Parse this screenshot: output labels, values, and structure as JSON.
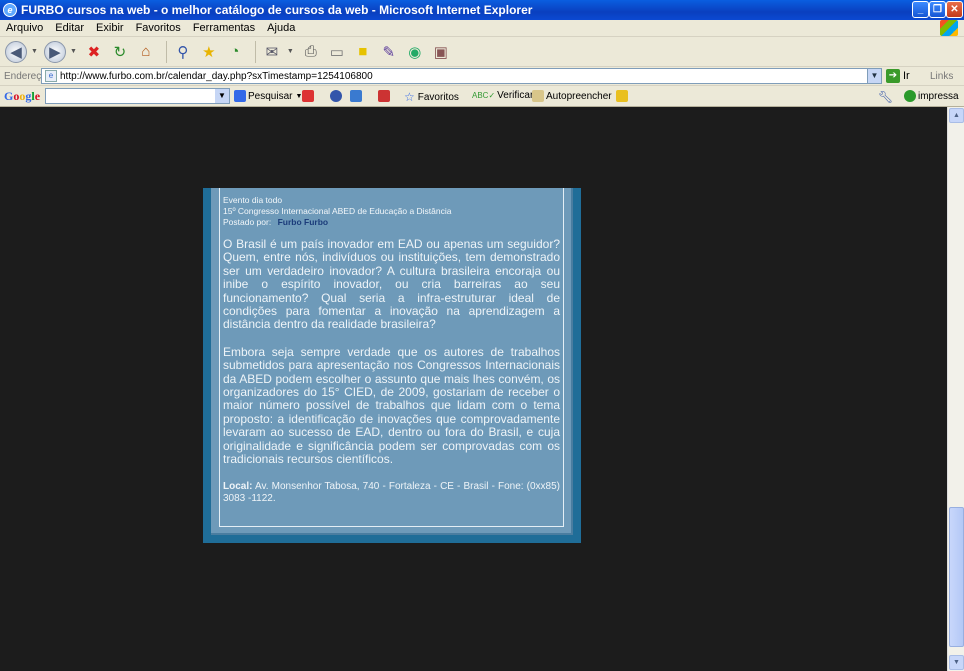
{
  "window": {
    "title": "FURBO cursos na web - o melhor catálogo de cursos da web - Microsoft Internet Explorer",
    "minimize": "_",
    "maximize": "❐",
    "close": "✕"
  },
  "menu": {
    "items": [
      "Arquivo",
      "Editar",
      "Exibir",
      "Favoritos",
      "Ferramentas",
      "Ajuda"
    ]
  },
  "address": {
    "label": "Endereço",
    "url": "http://www.furbo.com.br/calendar_day.php?sxTimestamp=1254106800",
    "go_label": "Ir",
    "links_label": "Links"
  },
  "google_bar": {
    "logo": "Google",
    "search_label": "Pesquisar",
    "favoritos_label": "Favoritos",
    "verificar_label": "Verificar",
    "autopreencher_label": "Autopreencher",
    "impressa_label": "impressa"
  },
  "event": {
    "kind": "Evento dia todo",
    "title": "15º Congresso Internacional ABED de Educação a Distância",
    "posted_by_label": "Postado por:",
    "author": "Furbo Furbo",
    "paragraph1": "O Brasil é um país inovador em EAD ou apenas um seguidor? Quem, entre nós, indivíduos ou instituições, tem demonstrado ser um verdadeiro inovador? A cultura brasileira encoraja ou inibe o espírito inovador, ou cria barreiras ao seu funcionamento? Qual seria a infra-estruturar ideal de condições para fomentar a inovação na aprendizagem a distância dentro da realidade brasileira?",
    "paragraph2": "Embora seja sempre verdade que os autores de trabalhos submetidos para apresentação nos Congressos Internacionais da ABED podem escolher o assunto que mais lhes convém, os organizadores do 15° CIED, de 2009, gostariam de receber o maior número possível de trabalhos que lidam com o tema proposto: a identificação de inovações que comprovadamente levaram ao sucesso de EAD, dentro ou fora do Brasil, e cuja originalidade e significância podem ser comprovadas com os tradicionais recursos científicos.",
    "local_label": "Local:",
    "local_value": "Av. Monsenhor Tabosa, 740 - Fortaleza - CE - Brasil - Fone: (0xx85) 3083 -1122."
  },
  "colors": {
    "background": "#1c1c1c",
    "panel_outer": "#1f6d98",
    "panel_inner": "#6e9ab9",
    "author_link": "#1b3c7a"
  }
}
